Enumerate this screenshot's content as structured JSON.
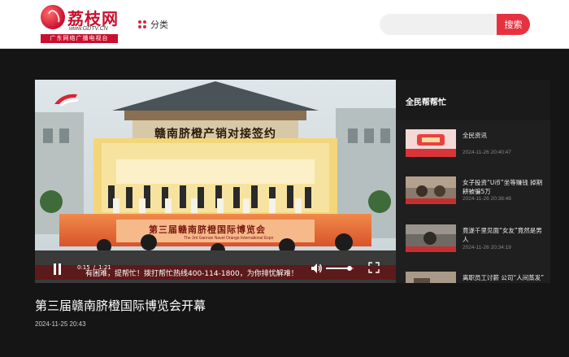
{
  "header": {
    "logo": {
      "name": "荔枝网",
      "url": "www.GDTV.CN",
      "tagline": "广东网络广播电视台"
    },
    "category_label": "分类",
    "search": {
      "placeholder": "",
      "button_label": "搜索"
    }
  },
  "player": {
    "frame": {
      "banner_title": "赣南脐橙产销对接签约",
      "stage_title": "第三届赣南脐橙国际博览会",
      "stage_subtitle": "The 3rd Gannan Navel Orange International Expo",
      "ticker": "有困难，提帮忙！拨打帮忙热线400-114-1800，为你排忧解难！"
    },
    "current_time": "0:15",
    "time_separator": "/",
    "duration": "1:21",
    "volume_level": 0.85
  },
  "article": {
    "title": "第三届赣南脐橙国际博览会开幕",
    "date": "2024-11-25 20:43"
  },
  "sidebar": {
    "title": "全民帮帮忙",
    "items": [
      {
        "title": "全民资讯",
        "time": "2024-11-26 20:40:47"
      },
      {
        "title": "女子投资“U币”坐等赚钱 掉期耕被骗5万",
        "time": "2024-11-26 20:38:48"
      },
      {
        "title": "竟遂千里见面“女友”竟然是男人",
        "time": "2024-11-26 20:34:19"
      },
      {
        "title": "离职员工讨薪 公司“人间蒸发”",
        "time": ""
      }
    ]
  },
  "colors": {
    "brand_red": "#c8102e",
    "search_button": "#e63240",
    "page_background": "#151515",
    "sidebar_background": "#1f1f1f"
  },
  "icons": [
    "category-icon",
    "play-pause-icon",
    "volume-icon",
    "fullscreen-icon"
  ]
}
